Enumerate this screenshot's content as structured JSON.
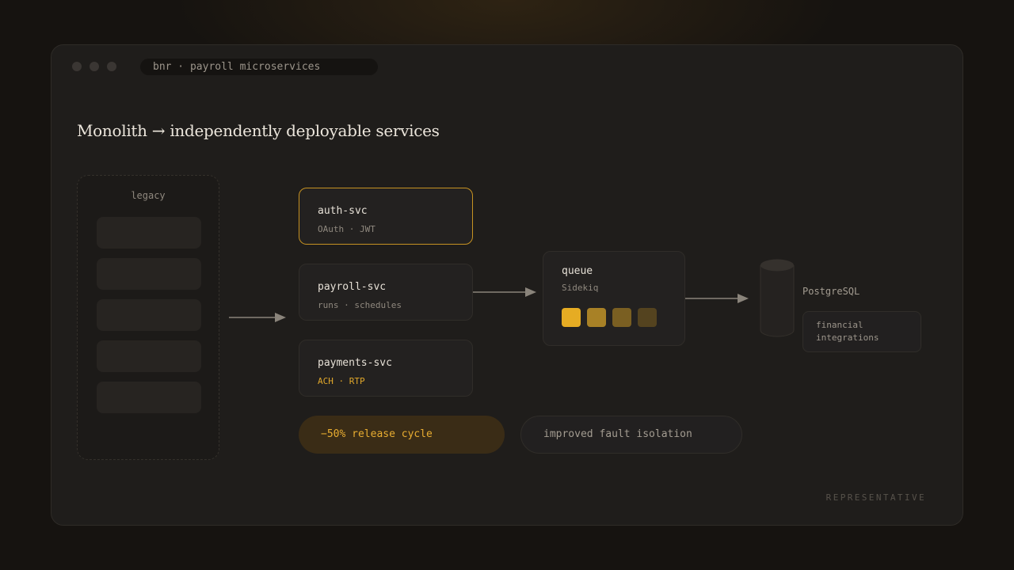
{
  "window": {
    "title": "bnr · payroll microservices"
  },
  "heading": "Monolith → independently deployable services",
  "legacy": {
    "label": "legacy",
    "block_count": 5
  },
  "services": [
    {
      "name": "auth-svc",
      "detail": "OAuth · JWT",
      "highlighted": true
    },
    {
      "name": "payroll-svc",
      "detail": "runs · schedules",
      "highlighted": false
    },
    {
      "name": "payments-svc",
      "detail": "ACH · RTP",
      "highlighted": false
    }
  ],
  "queue": {
    "name": "queue",
    "detail": "Sidekiq",
    "job_colors": [
      "#e6ac23",
      "#a88126",
      "#7a5f22",
      "#54431f"
    ]
  },
  "database": {
    "name": "PostgreSQL"
  },
  "integrations": {
    "label": "financial\nintegrations"
  },
  "outcomes": {
    "primary": "−50% release cycle",
    "secondary": "improved fault isolation"
  },
  "footer_tag": "REPRESENTATIVE",
  "colors": {
    "accent": "#e0a72a",
    "accent_border": "#c69222",
    "arrow": "#8a847b"
  }
}
